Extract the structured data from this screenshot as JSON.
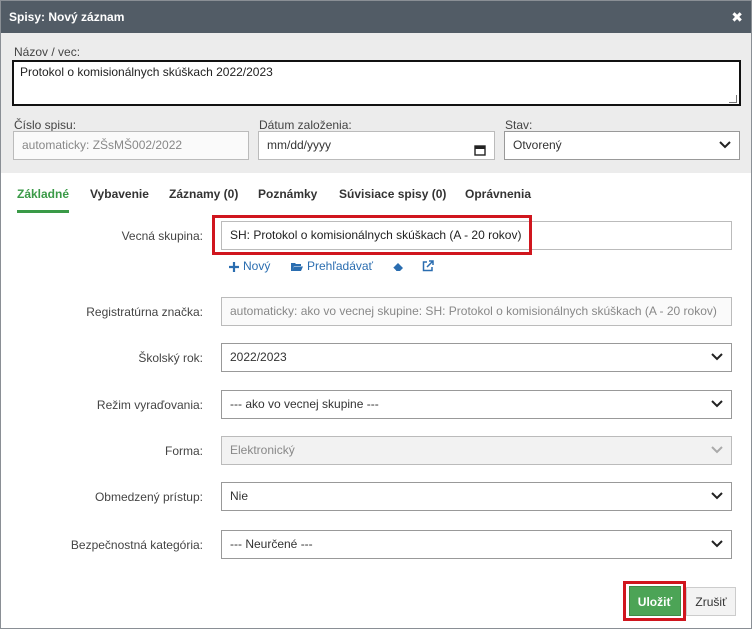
{
  "dialog": {
    "title": "Spisy: Nový záznam",
    "close_symbol": "✖"
  },
  "top": {
    "name_label": "Názov / vec:",
    "name_value": "Protokol o komisionálnych skúškach 2022/2023",
    "file_number_label": "Číslo spisu:",
    "file_number_placeholder": "automaticky: ZŠsMŠ002/2022",
    "date_label": "Dátum založenia:",
    "date_placeholder": "mm/dd/yyyy",
    "status_label": "Stav:",
    "status_value": "Otvorený"
  },
  "tabs": [
    {
      "label": "Základné",
      "active": true
    },
    {
      "label": "Vybavenie"
    },
    {
      "label": "Záznamy (0)"
    },
    {
      "label": "Poznámky"
    },
    {
      "label": "Súvisiace spisy (0)"
    },
    {
      "label": "Oprávnenia"
    }
  ],
  "form": {
    "subject_group_label": "Vecná skupina:",
    "subject_group_value": "SH: Protokol o komisionálnych skúškach (A - 20 rokov)",
    "actions": {
      "new": "Nový",
      "browse": "Prehľadávať"
    },
    "registry_label": "Registratúrna značka:",
    "registry_placeholder": "automaticky: ako vo vecnej skupine: SH: Protokol o komisionálnych skúškach (A - 20 rokov)",
    "school_year_label": "Školský rok:",
    "school_year_value": "2022/2023",
    "disposal_label": "Režim vyraďovania:",
    "disposal_value": "--- ako vo vecnej skupine ---",
    "form_label": "Forma:",
    "form_value": "Elektronický",
    "restricted_label": "Obmedzený prístup:",
    "restricted_value": "Nie",
    "security_label": "Bezpečnostná kategória:",
    "security_value": "--- Neurčené ---"
  },
  "buttons": {
    "save": "Uložiť",
    "cancel": "Zrušiť"
  },
  "colors": {
    "titlebar": "#525c66",
    "accent_green": "#3a9a47",
    "highlight_red": "#d0161e",
    "link_blue": "#2a6db0"
  }
}
